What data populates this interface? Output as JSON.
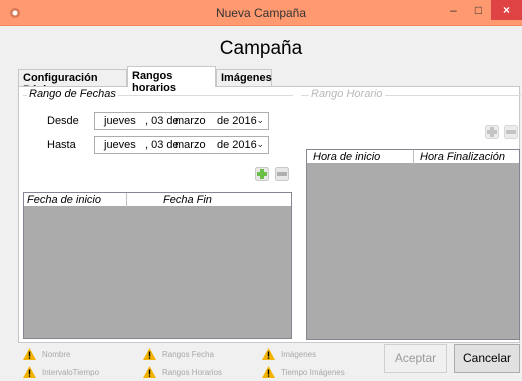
{
  "window": {
    "title": "Nueva Campaña",
    "minimize_glyph": "–",
    "maximize_glyph": "□",
    "close_glyph": "×"
  },
  "heading": "Campaña",
  "tabs": [
    {
      "label": "Configuración Básica"
    },
    {
      "label": "Rangos horarios"
    },
    {
      "label": "Imágenes"
    }
  ],
  "rango_fechas": {
    "legend": "Rango de Fechas",
    "desde_label": "Desde",
    "hasta_label": "Hasta",
    "desde": {
      "weekday": "jueves",
      "day": ", 03 de",
      "month": "marzo",
      "year": "de 2016"
    },
    "hasta": {
      "weekday": "jueves",
      "day": ", 03 de",
      "month": "marzo",
      "year": "de 2016"
    },
    "columns": [
      "Fecha de inicio",
      "Fecha Fin"
    ]
  },
  "rango_horario": {
    "legend": "Rango Horario",
    "columns": [
      "Hora de inicio",
      "Hora Finalización"
    ]
  },
  "validation": [
    {
      "label": "Nombre"
    },
    {
      "label": "Rangos Fecha"
    },
    {
      "label": "Imágenes"
    },
    {
      "label": "IntervaloTiempo"
    },
    {
      "label": "Rangos Horarios"
    },
    {
      "label": "Tiempo Imágenes"
    }
  ],
  "buttons": {
    "aceptar": "Aceptar",
    "cancelar": "Cancelar"
  },
  "colors": {
    "titlebar": "#ff9a70",
    "close": "#e04343",
    "grid_bg": "#ababab",
    "add_enabled": "#6cc04a",
    "warning": "#f2b400"
  },
  "icons": {
    "add": "plus-icon",
    "remove": "minus-icon",
    "warning": "warning-icon"
  }
}
